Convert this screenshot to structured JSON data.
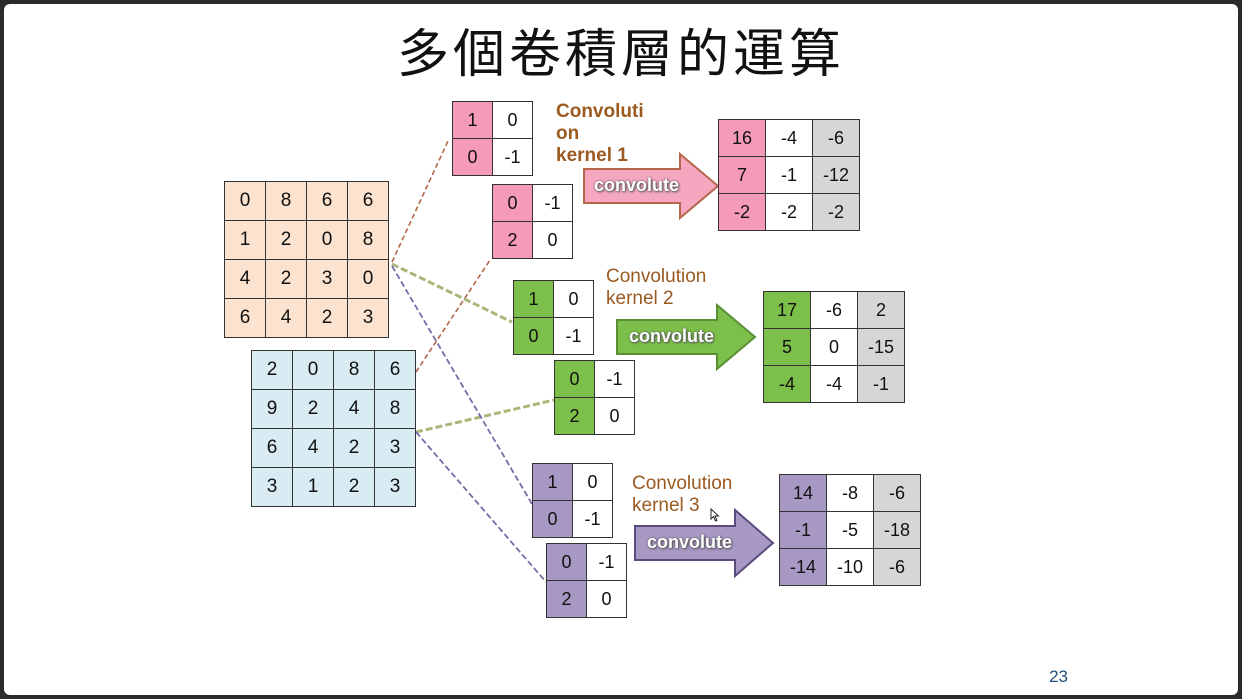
{
  "title": "多個卷積層的運算",
  "page_number": "23",
  "colors": {
    "input1_fill": "#fbe3cf",
    "input2_fill": "#d9ebf3",
    "kernel1_fill": "#f59ab9",
    "kernel2_fill": "#7cbf4a",
    "kernel3_fill": "#a898c4",
    "result_gray": "#d6d6d6",
    "label_color": "#9a5a20"
  },
  "input_channel_1": [
    [
      "0",
      "8",
      "6",
      "6"
    ],
    [
      "1",
      "2",
      "0",
      "8"
    ],
    [
      "4",
      "2",
      "3",
      "0"
    ],
    [
      "6",
      "4",
      "2",
      "3"
    ]
  ],
  "input_channel_2": [
    [
      "2",
      "0",
      "8",
      "6"
    ],
    [
      "9",
      "2",
      "4",
      "8"
    ],
    [
      "6",
      "4",
      "2",
      "3"
    ],
    [
      "3",
      "1",
      "2",
      "3"
    ]
  ],
  "kernels": [
    {
      "label_line1": "Convoluti",
      "label_line2": "on",
      "label_line3": "kernel 1",
      "a": [
        [
          "1",
          "0"
        ],
        [
          "0",
          "-1"
        ]
      ],
      "b": [
        [
          "0",
          "-1"
        ],
        [
          "2",
          "0"
        ]
      ],
      "arrow_label": "convolute",
      "result": [
        [
          "16",
          "-4",
          "-6"
        ],
        [
          "7",
          "-1",
          "-12"
        ],
        [
          "-2",
          "-2",
          "-2"
        ]
      ]
    },
    {
      "label_line1": "Convolution",
      "label_line2": "kernel 2",
      "a": [
        [
          "1",
          "0"
        ],
        [
          "0",
          "-1"
        ]
      ],
      "b": [
        [
          "0",
          "-1"
        ],
        [
          "2",
          "0"
        ]
      ],
      "arrow_label": "convolute",
      "result": [
        [
          "17",
          "-6",
          "2"
        ],
        [
          "5",
          "0",
          "-15"
        ],
        [
          "-4",
          "-4",
          "-1"
        ]
      ]
    },
    {
      "label_line1": "Convolution",
      "label_line2": "kernel 3",
      "a": [
        [
          "1",
          "0"
        ],
        [
          "0",
          "-1"
        ]
      ],
      "b": [
        [
          "0",
          "-1"
        ],
        [
          "2",
          "0"
        ]
      ],
      "arrow_label": "convolute",
      "result": [
        [
          "14",
          "-8",
          "-6"
        ],
        [
          "-1",
          "-5",
          "-18"
        ],
        [
          "-14",
          "-10",
          "-6"
        ]
      ]
    }
  ]
}
